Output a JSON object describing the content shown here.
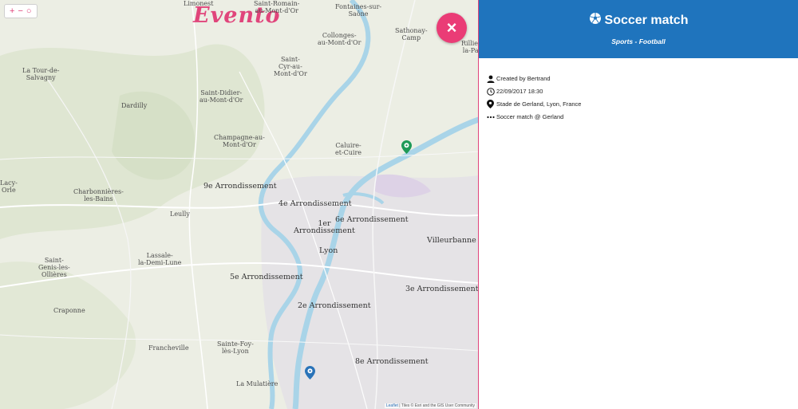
{
  "map": {
    "zoom_in": "+",
    "zoom_out": "−",
    "locate": "○",
    "logo": "Evento",
    "close": "×",
    "places": {
      "limonest": "Limonest",
      "saint_romain": "Saint-Romain-\nau-Mont-d'Or",
      "fontaines": "Fontaines-sur-\nSaône",
      "sathonay": "Sathonay-\nCamp",
      "rillieux": "Rillieux-\nla-Pape",
      "tour_salvagny": "La Tour-de-\nSalvagny",
      "collonges": "Collonges-\nau-Mont-d'Or",
      "saint_cyr": "Saint-\nCyr-au-\nMont-d'Or",
      "dardilly": "Dardilly",
      "saint_didier": "Saint-Didier-\nau-Mont-d'Or",
      "champagne": "Champagne-au-\nMont-d'Or",
      "caluire": "Caluire-\net-Cuire",
      "arr9": "9e Arrondissement",
      "charbonnieres": "Charbonnières-\nles-Bains",
      "arr4": "4e Arrondissement",
      "arr1": "1er\nArrondissement",
      "arr6": "6e Arrondissement",
      "villeurbanne": "Villeurbanne",
      "lyon": "Lyon",
      "lacy": "Lacy-\nOrle",
      "leully": "Leully",
      "lassale": "Lassale-\nla-Demi-Lune",
      "saint_genis": "Saint-\nGenis-les-\nOllières",
      "arr5": "5e Arrondissement",
      "arr3": "3e Arrondissement",
      "arr2": "2e Arrondissement",
      "craponne": "Craponne",
      "francheville": "Francheville",
      "sainte_foy": "Sainte-Foy-\nlès-Lyon",
      "arr8": "8e Arrondissement",
      "mulatiere": "La Mulatière"
    },
    "attribution_leaflet": "Leaflet",
    "attribution_text": " | Tiles © Esri and the GIS User Community"
  },
  "panel": {
    "title": "Soccer match",
    "subtitle": "Sports - Football",
    "created_by": "Created by Bertrand",
    "datetime": "22/09/2017 18:30",
    "location": "Stade de Gerland, Lyon, France",
    "description": "Soccer match @ Gerland"
  },
  "colors": {
    "header_blue": "#1f74bd",
    "accent_pink": "#ea3c76",
    "marker_green": "#1e9a57",
    "marker_blue": "#2a73b8",
    "river": "#a9d4e8"
  }
}
